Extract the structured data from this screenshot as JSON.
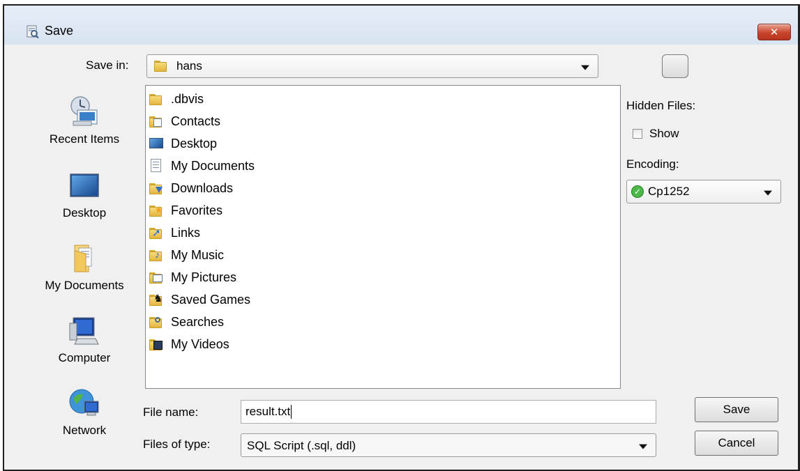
{
  "window": {
    "title": "Save",
    "close_glyph": "✕"
  },
  "save_in": {
    "label": "Save in:",
    "value": "hans"
  },
  "places": [
    {
      "label": "Recent Items",
      "icon": "recent-items-icon"
    },
    {
      "label": "Desktop",
      "icon": "desktop-icon"
    },
    {
      "label": "My Documents",
      "icon": "my-documents-icon"
    },
    {
      "label": "Computer",
      "icon": "computer-icon"
    },
    {
      "label": "Network",
      "icon": "network-icon"
    }
  ],
  "files": [
    {
      "name": ".dbvis",
      "icon": "folder-icon"
    },
    {
      "name": "Contacts",
      "icon": "contacts-folder-icon"
    },
    {
      "name": "Desktop",
      "icon": "desktop-folder-icon"
    },
    {
      "name": "My Documents",
      "icon": "documents-folder-icon"
    },
    {
      "name": "Downloads",
      "icon": "downloads-folder-icon"
    },
    {
      "name": "Favorites",
      "icon": "favorites-folder-icon"
    },
    {
      "name": "Links",
      "icon": "links-folder-icon"
    },
    {
      "name": "My Music",
      "icon": "music-folder-icon"
    },
    {
      "name": "My Pictures",
      "icon": "pictures-folder-icon"
    },
    {
      "name": "Saved Games",
      "icon": "saved-games-folder-icon"
    },
    {
      "name": "Searches",
      "icon": "searches-folder-icon"
    },
    {
      "name": "My Videos",
      "icon": "videos-folder-icon"
    }
  ],
  "options": {
    "hidden_files_label": "Hidden Files:",
    "show_label": "Show",
    "show_checked": false,
    "encoding_label": "Encoding:",
    "encoding_value": "Cp1252"
  },
  "form": {
    "file_name_label": "File name:",
    "file_name_value": "result.txt",
    "files_of_type_label": "Files of type:",
    "files_of_type_value": "SQL Script (.sql, ddl)"
  },
  "buttons": {
    "save": "Save",
    "cancel": "Cancel"
  },
  "colors": {
    "title_bar": "#dee7f2",
    "client": "#f0f0f0",
    "close_button": "#c8442d",
    "encoding_ok": "#4cb84a"
  }
}
